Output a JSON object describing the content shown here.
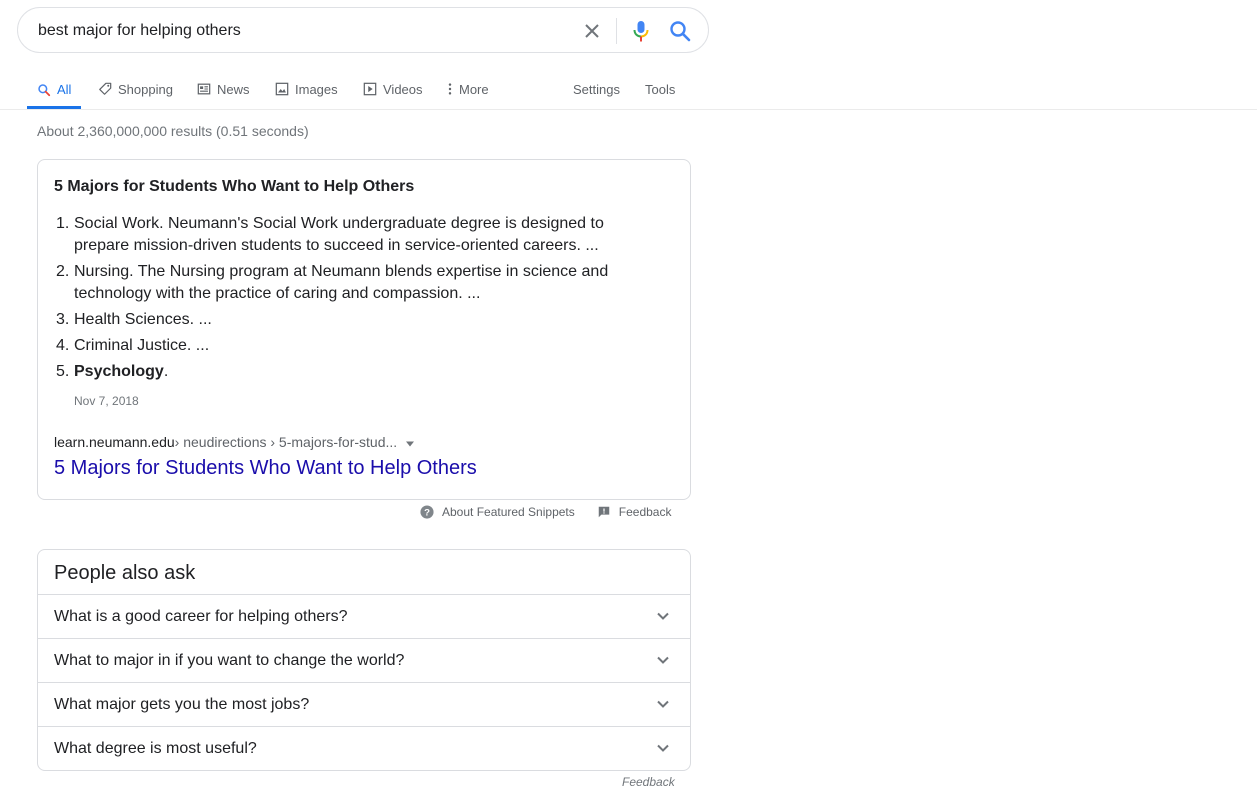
{
  "search": {
    "query": "best major for helping others"
  },
  "tabs": [
    {
      "label": "All",
      "icon": "search-icon"
    },
    {
      "label": "Shopping",
      "icon": "tag-icon"
    },
    {
      "label": "News",
      "icon": "newspaper-icon"
    },
    {
      "label": "Images",
      "icon": "image-icon"
    },
    {
      "label": "Videos",
      "icon": "play-icon"
    },
    {
      "label": "More",
      "icon": "more-vert-icon"
    },
    {
      "label": "Settings"
    },
    {
      "label": "Tools"
    }
  ],
  "result_stats": "About 2,360,000,000 results (0.51 seconds)",
  "snippet": {
    "title": "5 Majors for Students Who Want to Help Others",
    "items": [
      {
        "num": "1.",
        "text": "Social Work. Neumann's Social Work undergraduate degree is designed to prepare mission-driven students to succeed in service-oriented careers. ..."
      },
      {
        "num": "2.",
        "text": "Nursing. The Nursing program at Neumann blends expertise in science and technology with the practice of caring and compassion. ..."
      },
      {
        "num": "3.",
        "text": "Health Sciences. ..."
      },
      {
        "num": "4.",
        "text": "Criminal Justice. ..."
      },
      {
        "num": "5.",
        "bold": "Psychology",
        "text": "."
      }
    ],
    "date": "Nov 7, 2018",
    "domain": "learn.neumann.edu",
    "crumbs": " › neudirections › 5-majors-for-stud...",
    "link_text": "5 Majors for Students Who Want to Help Others"
  },
  "snippet_footer": {
    "about": "About Featured Snippets",
    "feedback": "Feedback"
  },
  "paa": {
    "title": "People also ask",
    "questions": [
      "What is a good career for helping others?",
      "What to major in if you want to change the world?",
      "What major gets you the most jobs?",
      "What degree is most useful?"
    ],
    "feedback": "Feedback"
  },
  "colors": {
    "accent": "#1a73e8",
    "link": "#1a0dab",
    "muted": "#70757a",
    "border": "#dadce0"
  }
}
